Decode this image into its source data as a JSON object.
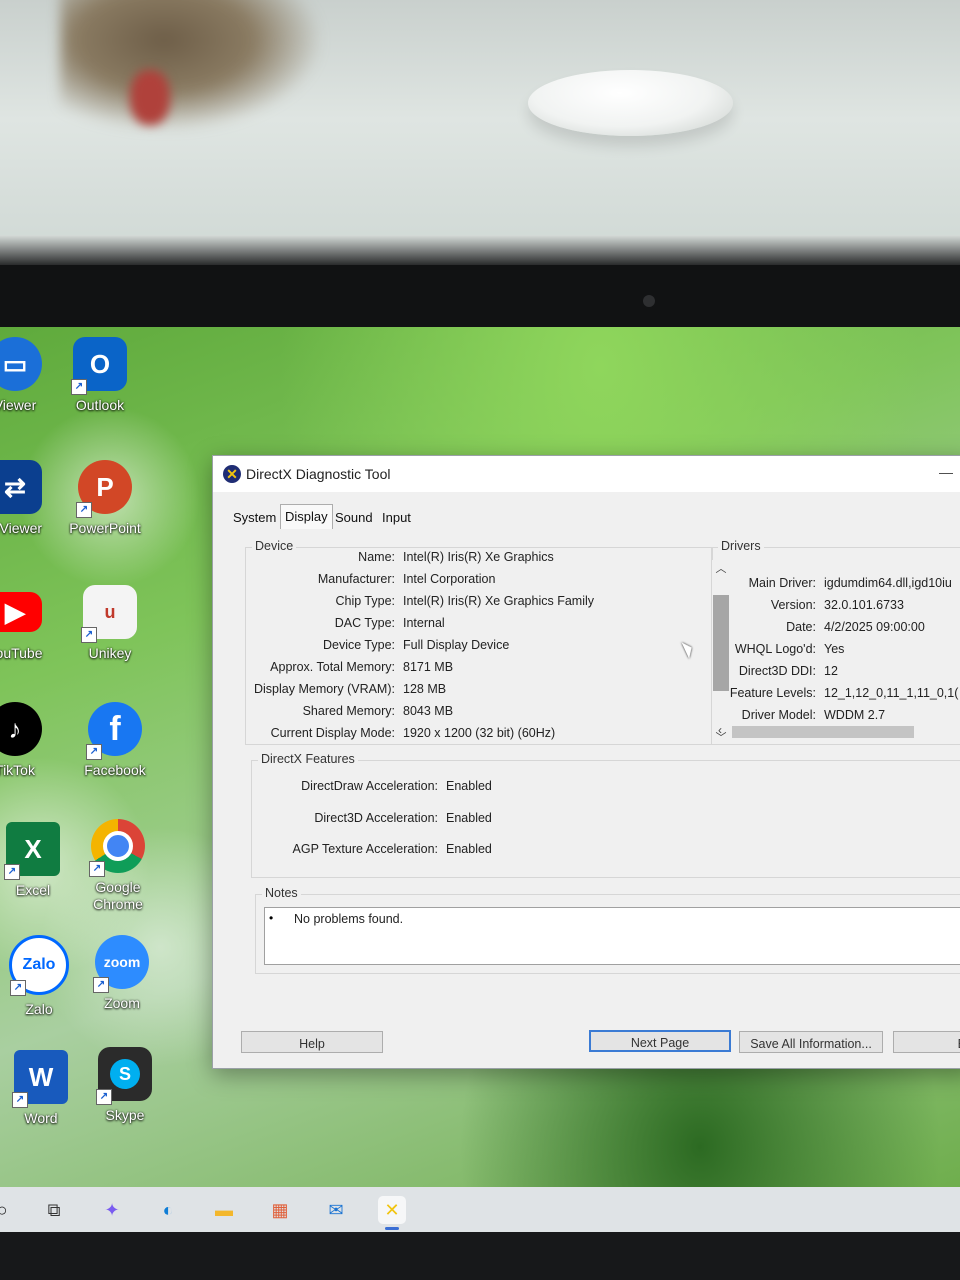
{
  "desktop": {
    "icons": [
      {
        "label": "Viewer",
        "glyph": "▭",
        "color": "#1b6fd8"
      },
      {
        "label": "Outlook",
        "glyph": "O",
        "color": "#0a64c8"
      },
      {
        "label": "mViewer",
        "glyph": "⇄",
        "color": "#0b3f8f"
      },
      {
        "label": "PowerPoint",
        "glyph": "P",
        "color": "#d24726"
      },
      {
        "label": "YouTube",
        "glyph": "▶",
        "color": "#ff0000"
      },
      {
        "label": "Unikey",
        "glyph": "u",
        "color": "#f4f4f4"
      },
      {
        "label": "TikTok",
        "glyph": "♪",
        "color": "#000000"
      },
      {
        "label": "Facebook",
        "glyph": "f",
        "color": "#1877f2"
      },
      {
        "label": "Excel",
        "glyph": "X",
        "color": "#107c41"
      },
      {
        "label": "Google\nChrome",
        "glyph": "◉",
        "color": "#ffffff"
      },
      {
        "label": "Zalo",
        "glyph": "Zalo",
        "color": "#ffffff"
      },
      {
        "label": "Zoom",
        "glyph": "zoom",
        "color": "#2d8cff"
      },
      {
        "label": "Word",
        "glyph": "W",
        "color": "#185abd"
      },
      {
        "label": "Skype",
        "glyph": "S",
        "color": "#00aff0"
      }
    ]
  },
  "window": {
    "title": "DirectX Diagnostic Tool",
    "tabs": [
      {
        "label": "System"
      },
      {
        "label": "Display"
      },
      {
        "label": "Sound"
      },
      {
        "label": "Input"
      }
    ],
    "active_tab": "Display",
    "device": {
      "title": "Device",
      "rows": [
        {
          "key": "Name:",
          "value": "Intel(R) Iris(R) Xe Graphics"
        },
        {
          "key": "Manufacturer:",
          "value": "Intel Corporation"
        },
        {
          "key": "Chip Type:",
          "value": "Intel(R) Iris(R) Xe Graphics Family"
        },
        {
          "key": "DAC Type:",
          "value": "Internal"
        },
        {
          "key": "Device Type:",
          "value": "Full Display Device"
        },
        {
          "key": "Approx. Total Memory:",
          "value": "8171 MB"
        },
        {
          "key": "Display Memory (VRAM):",
          "value": "128 MB"
        },
        {
          "key": "Shared Memory:",
          "value": "8043 MB"
        },
        {
          "key": "Current Display Mode:",
          "value": "1920 x 1200 (32 bit) (60Hz)"
        }
      ]
    },
    "drivers": {
      "title": "Drivers",
      "rows": [
        {
          "key": "Main Driver:",
          "value": "igdumdim64.dll,igd10iu"
        },
        {
          "key": "Version:",
          "value": "32.0.101.6733"
        },
        {
          "key": "Date:",
          "value": "4/2/2025 09:00:00"
        },
        {
          "key": "WHQL Logo'd:",
          "value": "Yes"
        },
        {
          "key": "Direct3D DDI:",
          "value": "12"
        },
        {
          "key": "Feature Levels:",
          "value": "12_1,12_0,11_1,11_0,1("
        },
        {
          "key": "Driver Model:",
          "value": "WDDM 2.7"
        }
      ]
    },
    "features": {
      "title": "DirectX Features",
      "rows": [
        {
          "key": "DirectDraw Acceleration:",
          "value": "Enabled"
        },
        {
          "key": "Direct3D Acceleration:",
          "value": "Enabled"
        },
        {
          "key": "AGP Texture Acceleration:",
          "value": "Enabled"
        }
      ]
    },
    "notes": {
      "title": "Notes",
      "bullet": "•",
      "text": "No problems found."
    },
    "buttons": {
      "help": "Help",
      "next_page": "Next Page",
      "save_all": "Save All Information...",
      "exit_partial": "E"
    }
  },
  "taskbar": {
    "items": [
      {
        "name": "search-icon",
        "glyph": "○",
        "color": "#222222"
      },
      {
        "name": "task-view-icon",
        "glyph": "⧉",
        "color": "#333333"
      },
      {
        "name": "copilot-icon",
        "glyph": "✦",
        "color": "#7a5cf0"
      },
      {
        "name": "edge-icon",
        "glyph": "◐",
        "color": "#0f7dd6"
      },
      {
        "name": "file-explorer-icon",
        "glyph": "▬",
        "color": "#f3b72c"
      },
      {
        "name": "microsoft-store-icon",
        "glyph": "▦",
        "color": "#e0603a"
      },
      {
        "name": "mail-icon",
        "glyph": "✉",
        "color": "#1a73d2"
      },
      {
        "name": "dxdiag-icon",
        "glyph": "✕",
        "color": "#f1c40f"
      }
    ]
  }
}
